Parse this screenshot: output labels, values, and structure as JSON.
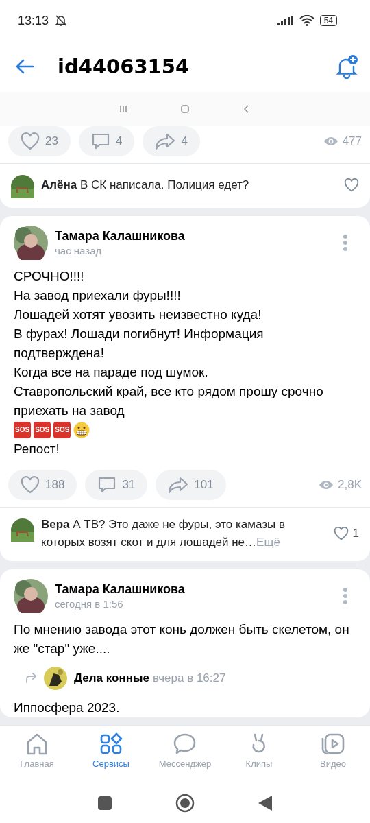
{
  "status_bar": {
    "time": "13:13",
    "battery": "54"
  },
  "header": {
    "title": "id44063154"
  },
  "posts": [
    {
      "kind": "tail",
      "actions": {
        "likes": "23",
        "comments": "4",
        "reposts": "4",
        "views": "477"
      },
      "comment": {
        "author": "Алёна",
        "text": "В СК написала. Полиция едет?"
      }
    },
    {
      "kind": "full",
      "author": "Тамара Калашникова",
      "time": "час назад",
      "lines": [
        "СРОЧНО!!!!",
        "На завод приехали фуры!!!!",
        "Лошадей хотят увозить неизвестно куда!",
        "В фурах! Лошади погибнут! Информация подтверждена!",
        "Когда все на параде под шумок.",
        "Ставропольский край, все кто рядом прошу срочно приехать на завод"
      ],
      "emoji": [
        {
          "kind": "sos",
          "label": "SOS"
        },
        {
          "kind": "sos",
          "label": "SOS"
        },
        {
          "kind": "sos",
          "label": "SOS"
        },
        {
          "kind": "grimace"
        }
      ],
      "after": [
        "Репост!"
      ],
      "actions": {
        "likes": "188",
        "comments": "31",
        "reposts": "101",
        "views": "2,8K"
      },
      "comment": {
        "author": "Вера",
        "text": "А ТВ? Это даже не фуры, это камазы в которых возят скот и для лошадей не…",
        "likes": "1",
        "more": "Ещё"
      }
    },
    {
      "kind": "full",
      "author": "Тамара Калашникова",
      "time": "сегодня в 1:56",
      "lines": [
        "По мнению завода этот конь должен быть скелетом, он же \"стар\" уже...."
      ],
      "repost": {
        "author": "Дела конные",
        "time": "вчера в 16:27"
      },
      "after": [
        "Иппосфера 2023."
      ]
    }
  ],
  "tabs": [
    {
      "label": "Главная",
      "selected": false
    },
    {
      "label": "Сервисы",
      "selected": true
    },
    {
      "label": "Мессенджер",
      "selected": false
    },
    {
      "label": "Клипы",
      "selected": false
    },
    {
      "label": "Видео",
      "selected": false
    }
  ]
}
